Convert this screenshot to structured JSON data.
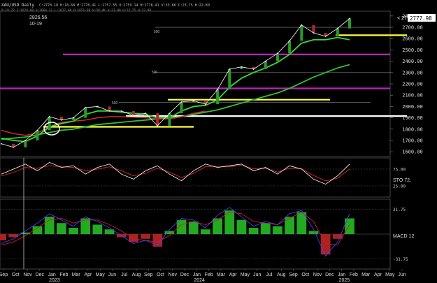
{
  "header": {
    "title": "XAU/USD Daily",
    "ohlc_line": "C:2778.18 H:18.68 H:2778.41 L:2757.55 O:2759.14 H:2778.41 V:33.6K C:23.75 H:22.80",
    "ohlc_line2": "8-19-22 C:1629.08 H:1664.31 L:1627.68 O:1651.09 V:58.4K H:23.00 H:23.75 H:22.80"
  },
  "annotations": {
    "peak_value": "2826.56",
    "peak_date": "10-19",
    "price_callout": "< 2777.98",
    "price_badge": "2777.98",
    "label_500_a": "500",
    "label_500_b": "500",
    "label_500_c": "500"
  },
  "chart_data": {
    "type": "line",
    "price_axis": {
      "ticks": [
        "2800.00",
        "2700.00",
        "2600.00",
        "2500.00",
        "2400.00",
        "2300.00",
        "2200.00",
        "2100.00",
        "2000.00",
        "1900.00",
        "1800.00",
        "1700.00",
        "1600.00"
      ],
      "ylim": [
        1570,
        2830
      ]
    },
    "months": [
      "Sep",
      "Oct",
      "Nov",
      "Dec",
      "Jan",
      "Feb",
      "Mar",
      "Apr",
      "May",
      "Jun",
      "Jul",
      "Aug",
      "Sep",
      "Oct",
      "Nov",
      "Dec",
      "Jan",
      "Feb",
      "Mar",
      "Apr",
      "May",
      "Jun",
      "Jul",
      "Aug",
      "Sep",
      "Oct",
      "Nov",
      "Dec",
      "Jan",
      "Feb",
      "Mar",
      "Apr",
      "May",
      "Jun"
    ],
    "years": [
      "2023",
      "2024",
      "2025"
    ],
    "price": [
      1670,
      1640,
      1700,
      1790,
      1910,
      1880,
      1900,
      1990,
      2000,
      1960,
      1960,
      1920,
      1940,
      1830,
      1940,
      2040,
      2050,
      2020,
      2150,
      2330,
      2350,
      2330,
      2400,
      2470,
      2580,
      2720,
      2650,
      2620,
      2690,
      2778
    ],
    "ma_fast": [
      1720,
      1700,
      1690,
      1740,
      1820,
      1850,
      1870,
      1930,
      1960,
      1960,
      1950,
      1940,
      1930,
      1900,
      1900,
      1960,
      2000,
      2010,
      2060,
      2170,
      2250,
      2300,
      2340,
      2390,
      2460,
      2560,
      2590,
      2590,
      2610,
      2590
    ],
    "ma_slow": [
      1710,
      1720,
      1730,
      1750,
      1770,
      1790,
      1800,
      1820,
      1840,
      1850,
      1860,
      1870,
      1880,
      1890,
      1900,
      1910,
      1930,
      1950,
      1970,
      2000,
      2030,
      2060,
      2090,
      2120,
      2160,
      2210,
      2260,
      2300,
      2340,
      2370
    ],
    "red_ma": [
      1790,
      1760,
      1745,
      1765,
      1820,
      1860,
      1870,
      1880,
      1900,
      1910,
      1910,
      1905,
      1900,
      1890,
      1890,
      1910,
      1940,
      1960
    ],
    "levels": [
      {
        "name": "magenta-top",
        "value": 2460,
        "color": "#c020c0"
      },
      {
        "name": "magenta-mid",
        "value": 2160,
        "color": "#c020c0"
      },
      {
        "name": "yellow-right",
        "value": 2630,
        "color": "#ffff40"
      },
      {
        "name": "yellow-mid",
        "value": 2060,
        "color": "#ffff40"
      },
      {
        "name": "yellow-left",
        "value": 1820,
        "color": "#ffff40"
      },
      {
        "name": "white-low",
        "value": 1915,
        "color": "#ffffff"
      },
      {
        "name": "grey-2700",
        "value": 2700,
        "color": "#888888"
      },
      {
        "name": "grey-2300",
        "value": 2300,
        "color": "#888888"
      },
      {
        "name": "grey-2035",
        "value": 2035,
        "color": "#888888"
      }
    ],
    "stochastic": {
      "label": "STO 72,",
      "ticks": [
        "75.00",
        "25.00"
      ],
      "k": [
        60,
        75,
        90,
        70,
        95,
        80,
        85,
        60,
        80,
        90,
        60,
        45,
        70,
        85,
        60,
        40,
        70,
        90,
        80,
        85,
        90,
        70,
        80,
        60,
        85,
        75,
        45,
        30,
        55,
        90
      ],
      "d": [
        55,
        65,
        80,
        78,
        85,
        82,
        80,
        70,
        75,
        82,
        70,
        55,
        62,
        78,
        66,
        50,
        62,
        82,
        82,
        82,
        86,
        76,
        78,
        66,
        78,
        76,
        56,
        40,
        48,
        75
      ]
    },
    "macd": {
      "label": "MACD 12",
      "ticks": [
        "31.75",
        "-31.75"
      ],
      "hist": [
        -8,
        -4,
        2,
        10,
        22,
        14,
        8,
        20,
        12,
        6,
        -4,
        -10,
        -6,
        -16,
        4,
        18,
        16,
        6,
        20,
        30,
        18,
        8,
        14,
        10,
        22,
        28,
        4,
        -26,
        -6,
        20
      ],
      "line": [
        -12,
        -6,
        4,
        14,
        26,
        18,
        10,
        22,
        16,
        8,
        -2,
        -12,
        -8,
        -14,
        6,
        20,
        18,
        8,
        24,
        34,
        22,
        10,
        16,
        12,
        26,
        30,
        6,
        -28,
        -10,
        26
      ],
      "signal": [
        -14,
        -10,
        -2,
        8,
        18,
        20,
        14,
        18,
        18,
        12,
        4,
        -6,
        -8,
        -10,
        -2,
        12,
        16,
        12,
        18,
        28,
        26,
        16,
        14,
        12,
        20,
        28,
        16,
        -12,
        -14,
        12
      ]
    }
  },
  "colors": {
    "background": "#000000",
    "price": "#ffffff",
    "ma_fast": "#33dd33",
    "ma_slow": "#30c030",
    "red_ma": "#d03030",
    "stoch_k": "#ffffff",
    "stoch_d": "#d02020",
    "macd_line": "#4040ff",
    "macd_signal": "#d02020",
    "hist_pos": "#22aa22",
    "hist_neg": "#aa2222"
  }
}
